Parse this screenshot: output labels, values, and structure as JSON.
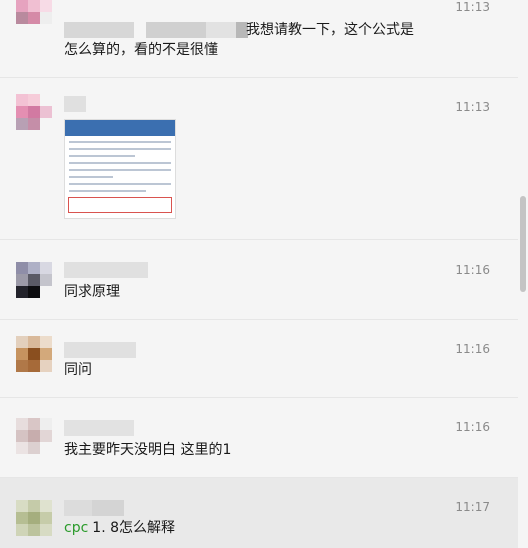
{
  "messages": [
    {
      "time": "11:13",
      "text_lines": [
        "我想请教一下，这个公式是",
        "怎么算的，看的不是很懂"
      ]
    },
    {
      "time": "11:13",
      "image": "screenshot-thumbnail"
    },
    {
      "time": "11:16",
      "text": "同求原理"
    },
    {
      "time": "11:16",
      "text": "同问"
    },
    {
      "time": "11:16",
      "text": "我主要昨天没明白 这里的1"
    },
    {
      "time": "11:17",
      "mention": "cpc",
      "text": "1. 8怎么解释"
    }
  ],
  "colors": {
    "background": "#f5f5f5",
    "highlight_row": "#e9e9e9",
    "mention": "#2b9b2b",
    "time": "#8a8a8a"
  }
}
